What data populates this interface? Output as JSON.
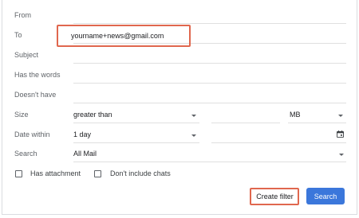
{
  "filter_form": {
    "from": {
      "label": "From"
    },
    "to": {
      "label": "To",
      "value": "yourname+news@gmail.com"
    },
    "subject": {
      "label": "Subject"
    },
    "has_words": {
      "label": "Has the words"
    },
    "doesnt_have": {
      "label": "Doesn't have"
    },
    "size": {
      "label": "Size",
      "operator": "greater than",
      "unit": "MB"
    },
    "date_within": {
      "label": "Date within",
      "value": "1 day"
    },
    "search": {
      "label": "Search",
      "value": "All Mail"
    },
    "has_attachment": {
      "label": "Has attachment",
      "checked": false
    },
    "dont_include_chats": {
      "label": "Don't include chats",
      "checked": false
    },
    "buttons": {
      "create_filter": "Create filter",
      "search": "Search"
    }
  },
  "colors": {
    "highlight": "#e0674e",
    "primary_button": "#3b77db"
  }
}
